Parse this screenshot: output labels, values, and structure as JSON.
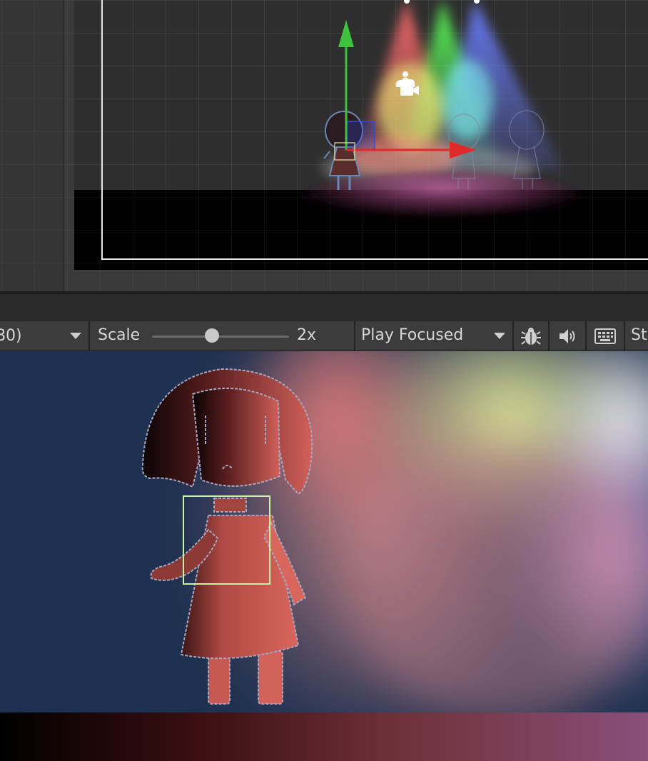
{
  "toolbar": {
    "resolution_label": "80)",
    "scale_label": "Scale",
    "scale_value_label": "2x",
    "scale_fraction": 0.44,
    "play_mode_label": "Play Focused",
    "stats_label": "St"
  },
  "icons": {
    "resolution_caret": "chevron-down-icon",
    "play_mode_caret": "chevron-down-icon",
    "debug": "bug-icon",
    "audio": "speaker-icon",
    "keyboard": "keyboard-icon",
    "scene_light": "light-bulb-icon",
    "scene_camera": "camera-icon"
  },
  "colors": {
    "editor_background": "#3a3a3a",
    "toolbar_background": "#3c3c3c",
    "gizmo_x_axis": "#e02a2a",
    "gizmo_y_axis": "#3ec23e",
    "gizmo_plane": "#2f3ac7",
    "selection_box": "#c6f5a6",
    "spotlight_red": "#ff6b6b",
    "spotlight_green": "#59ff59",
    "spotlight_blue": "#6a7dff",
    "spotlight_yellow": "#ffff80",
    "game_background": "#1f3150"
  }
}
